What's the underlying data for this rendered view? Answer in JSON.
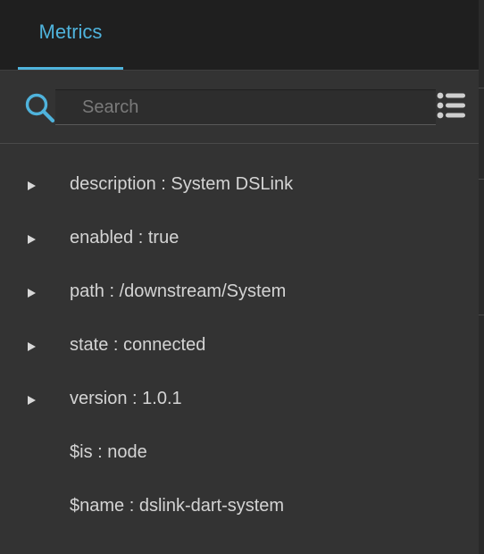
{
  "header": {
    "tabs": [
      {
        "label": "Metrics",
        "active": true
      }
    ]
  },
  "search": {
    "placeholder": "Search",
    "value": "",
    "icon": "search-icon",
    "menu_icon": "list-icon"
  },
  "colors": {
    "accent": "#4fb3dc",
    "background": "#333333",
    "header_bg": "#1f1f1f",
    "text": "#d4d4d4"
  },
  "tree": {
    "items": [
      {
        "label": "description : System DSLink",
        "expandable": true
      },
      {
        "label": "enabled : true",
        "expandable": true
      },
      {
        "label": "path : /downstream/System",
        "expandable": true
      },
      {
        "label": "state : connected",
        "expandable": true
      },
      {
        "label": "version : 1.0.1",
        "expandable": true
      },
      {
        "label": "$is : node",
        "expandable": false
      },
      {
        "label": "$name : dslink-dart-system",
        "expandable": false
      }
    ]
  }
}
